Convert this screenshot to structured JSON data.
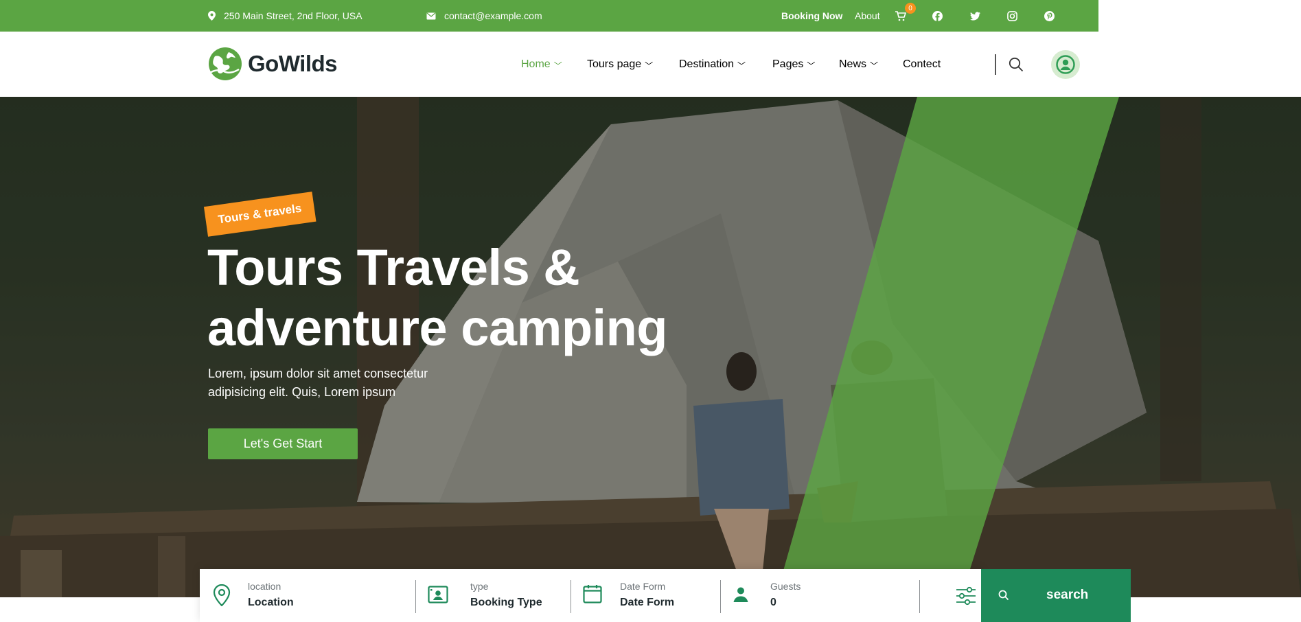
{
  "topbar": {
    "address": "250 Main Street, 2nd Floor, USA",
    "email": "contact@example.com",
    "booking": "Booking Now",
    "about": "About",
    "cart_count": "0",
    "social": [
      "facebook-icon",
      "twitter-icon",
      "instagram-icon",
      "pinterest-icon"
    ]
  },
  "header": {
    "logo_text": "GoWilds",
    "nav": [
      {
        "label": "Home",
        "active": true
      },
      {
        "label": "Tours page"
      },
      {
        "label": "Destination"
      },
      {
        "label": "Pages"
      },
      {
        "label": "News"
      },
      {
        "label": "Contect"
      }
    ]
  },
  "hero": {
    "tag": "Tours & travels",
    "title_line1": "Tours Travels &",
    "title_line2": "adventure camping",
    "subtitle": "Lorem, ipsum dolor sit amet consectetur adipisicing elit. Quis, Lorem ipsum",
    "cta": "Let's Get Start"
  },
  "booking": {
    "location": {
      "label": "location",
      "value": "Location"
    },
    "type": {
      "label": "type",
      "value": "Booking Type"
    },
    "date": {
      "label": "Date Form",
      "value": "Date Form"
    },
    "guests": {
      "label": "Guests",
      "value": "0"
    },
    "search": "search"
  },
  "colors": {
    "brand_green": "#5ba543",
    "dark_green": "#1e8a5a",
    "orange": "#f7921e"
  }
}
